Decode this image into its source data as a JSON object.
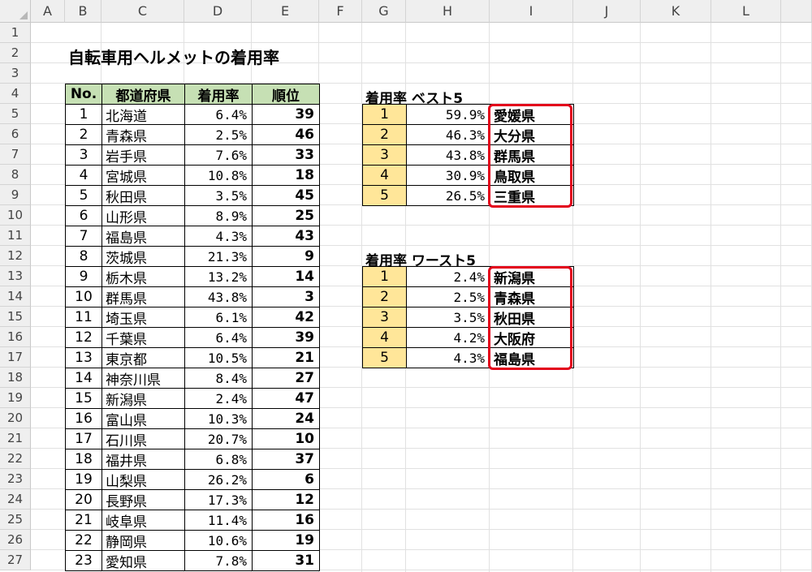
{
  "sheet": {
    "columns": [
      "A",
      "B",
      "C",
      "D",
      "E",
      "F",
      "G",
      "H",
      "I",
      "J",
      "K",
      "L"
    ],
    "rows": [
      "1",
      "2",
      "3",
      "4",
      "5",
      "6",
      "7",
      "8",
      "9",
      "10",
      "11",
      "12",
      "13",
      "14",
      "15",
      "16",
      "17",
      "18",
      "19",
      "20",
      "21",
      "22",
      "23",
      "24",
      "25",
      "26",
      "27"
    ],
    "title": "自転車用ヘルメットの着用率"
  },
  "main_table": {
    "headers": [
      "No.",
      "都道府県",
      "着用率",
      "順位"
    ],
    "rows": [
      [
        "1",
        "北海道",
        "6.4%",
        "39"
      ],
      [
        "2",
        "青森県",
        "2.5%",
        "46"
      ],
      [
        "3",
        "岩手県",
        "7.6%",
        "33"
      ],
      [
        "4",
        "宮城県",
        "10.8%",
        "18"
      ],
      [
        "5",
        "秋田県",
        "3.5%",
        "45"
      ],
      [
        "6",
        "山形県",
        "8.9%",
        "25"
      ],
      [
        "7",
        "福島県",
        "4.3%",
        "43"
      ],
      [
        "8",
        "茨城県",
        "21.3%",
        "9"
      ],
      [
        "9",
        "栃木県",
        "13.2%",
        "14"
      ],
      [
        "10",
        "群馬県",
        "43.8%",
        "3"
      ],
      [
        "11",
        "埼玉県",
        "6.1%",
        "42"
      ],
      [
        "12",
        "千葉県",
        "6.4%",
        "39"
      ],
      [
        "13",
        "東京都",
        "10.5%",
        "21"
      ],
      [
        "14",
        "神奈川県",
        "8.4%",
        "27"
      ],
      [
        "15",
        "新潟県",
        "2.4%",
        "47"
      ],
      [
        "16",
        "富山県",
        "10.3%",
        "24"
      ],
      [
        "17",
        "石川県",
        "20.7%",
        "10"
      ],
      [
        "18",
        "福井県",
        "6.8%",
        "37"
      ],
      [
        "19",
        "山梨県",
        "26.2%",
        "6"
      ],
      [
        "20",
        "長野県",
        "17.3%",
        "12"
      ],
      [
        "21",
        "岐阜県",
        "11.4%",
        "16"
      ],
      [
        "22",
        "静岡県",
        "10.6%",
        "19"
      ],
      [
        "23",
        "愛知県",
        "7.8%",
        "31"
      ]
    ]
  },
  "best5": {
    "label": "着用率 ベスト5",
    "rows": [
      [
        "1",
        "59.9%",
        "愛媛県"
      ],
      [
        "2",
        "46.3%",
        "大分県"
      ],
      [
        "3",
        "43.8%",
        "群馬県"
      ],
      [
        "4",
        "30.9%",
        "鳥取県"
      ],
      [
        "5",
        "26.5%",
        "三重県"
      ]
    ]
  },
  "worst5": {
    "label": "着用率 ワースト5",
    "rows": [
      [
        "1",
        "2.4%",
        "新潟県"
      ],
      [
        "2",
        "2.5%",
        "青森県"
      ],
      [
        "3",
        "3.5%",
        "秋田県"
      ],
      [
        "4",
        "4.2%",
        "大阪府"
      ],
      [
        "5",
        "4.3%",
        "福島県"
      ]
    ]
  },
  "colors": {
    "header_green": "#c6e0b4",
    "rank_yellow": "#ffe699",
    "highlight_red": "#e3001b"
  }
}
